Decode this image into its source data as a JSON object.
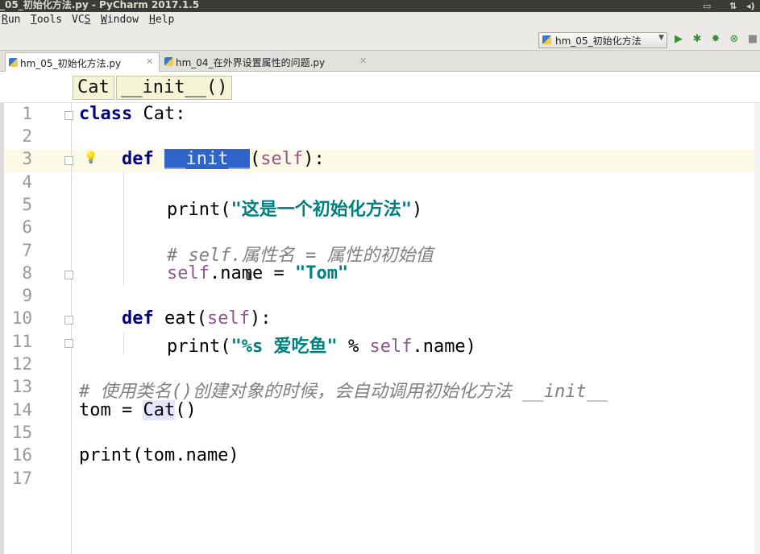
{
  "window": {
    "title": "_05_初始化方法.py - PyCharm 2017.1.5"
  },
  "menu": {
    "items": [
      {
        "label": "Run",
        "mnemonic": "R"
      },
      {
        "label": "Tools",
        "mnemonic": "T"
      },
      {
        "label": "VCS",
        "mnemonic": "S"
      },
      {
        "label": "Window",
        "mnemonic": "W"
      },
      {
        "label": "Help",
        "mnemonic": "H"
      }
    ]
  },
  "toolbar": {
    "run_config": "hm_05_初始化方法",
    "icons": [
      "run-icon",
      "debug-icon",
      "coverage-icon",
      "profile-icon",
      "stop-icon"
    ]
  },
  "tabs": [
    {
      "label": "hm_05_初始化方法.py",
      "active": true
    },
    {
      "label": "hm_04_在外界设置属性的问题.py",
      "active": false
    }
  ],
  "breadcrumb": [
    "Cat",
    "__init__()"
  ],
  "editor": {
    "line_numbers": [
      "1",
      "2",
      "3",
      "4",
      "5",
      "6",
      "7",
      "8",
      "9",
      "10",
      "11",
      "12",
      "13",
      "14",
      "15",
      "16",
      "17"
    ],
    "current_line": 3,
    "code": {
      "l1": {
        "kw": "class",
        "rest": " Cat:"
      },
      "l3": {
        "kw": "def",
        "sel": "__init__",
        "open": "(",
        "self": "self",
        "close": "):"
      },
      "l5": {
        "fn": "print(",
        "str": "\"这是一个初始化方法\"",
        "close": ")"
      },
      "l7": {
        "cmt": "# self.属性名 = 属性的初始值"
      },
      "l8": {
        "self": "self",
        "mid": ".name = ",
        "str": "\"Tom\""
      },
      "l10": {
        "kw": "def",
        "mid": " eat(",
        "self": "self",
        "close": "):"
      },
      "l11": {
        "fn": "print(",
        "str": "\"%s 爱吃鱼\"",
        "mid": " % ",
        "self": "self",
        "close": ".name)"
      },
      "l13": {
        "cmt": "# 使用类名()创建对象的时候，会自动调用初始化方法 __init__"
      },
      "l14": {
        "pre": "tom = ",
        "usage": "Cat",
        "close": "()"
      },
      "l16": {
        "text": "print(tom.name)"
      }
    }
  },
  "colors": {
    "keyword": "#000080",
    "string": "#008080",
    "self": "#94558d",
    "comment": "#808080",
    "selection": "#2f65ca",
    "current_line": "#fcfae6"
  }
}
